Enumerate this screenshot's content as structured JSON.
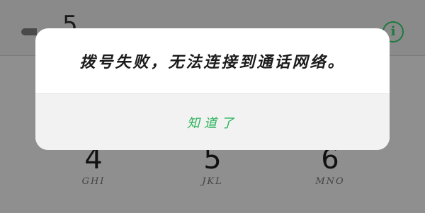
{
  "background": {
    "digit_peek": "5",
    "keys": [
      {
        "num": "4",
        "letters": "GHI"
      },
      {
        "num": "5",
        "letters": "JKL"
      },
      {
        "num": "6",
        "letters": "MNO"
      }
    ]
  },
  "dialog": {
    "message": "拨号失败，无法连接到通话网络。",
    "ok_label": "知道了"
  },
  "colors": {
    "accent": "#2bb35a",
    "overlay": "#8f8f8f",
    "info_icon": "#1d7a3e"
  },
  "icons": {
    "info": "info-circle-icon",
    "back": "back-icon"
  }
}
